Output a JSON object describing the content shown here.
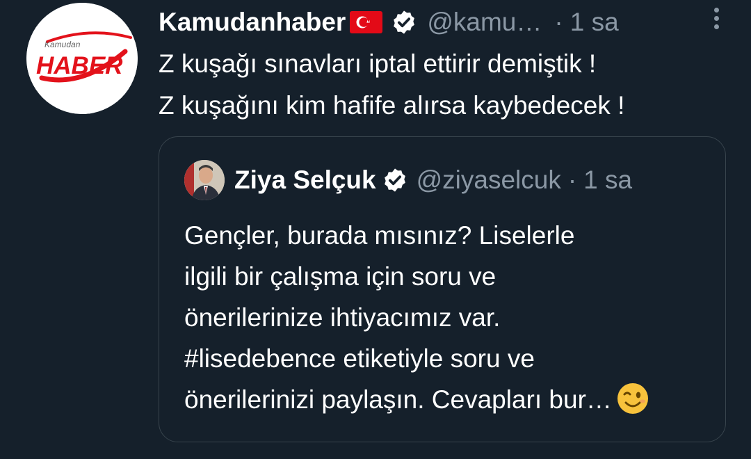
{
  "tweet": {
    "author": {
      "name": "Kamudanhaber",
      "handle": "@kamu…",
      "avatar_logo_top": "Kamudan",
      "avatar_logo_main": "HABER",
      "flag_icon": "turkey-flag-icon",
      "verified_icon": "verified-badge-icon"
    },
    "separator": "·",
    "time": "1 sa",
    "text_lines": [
      "Z kuşağı sınavları iptal ettirir demiştik !",
      "Z kuşağını kim hafife alırsa kaybedecek !"
    ],
    "more_icon": "more-vertical-icon"
  },
  "quoted_tweet": {
    "author": {
      "name": "Ziya Selçuk",
      "handle": "@ziyaselcuk",
      "verified_icon": "verified-badge-icon"
    },
    "separator": "·",
    "time": "1 sa",
    "text_lines": [
      "Gençler, burada mısınız? Liselerle",
      "ilgili bir çalışma için soru ve",
      "önerilerinize ihtiyacımız var.",
      "#lisedebence etiketiyle soru ve",
      "önerilerinizi paylaşın. Cevapları bur…"
    ],
    "trailing_emoji": "winking-face-icon"
  },
  "colors": {
    "background": "#15202b",
    "primary_text": "#ffffff",
    "secondary_text": "#8b98a5",
    "border": "#38444d",
    "brand_red": "#e3121b"
  }
}
